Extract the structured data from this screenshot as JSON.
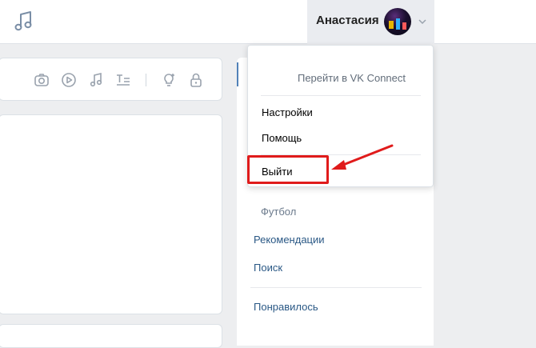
{
  "header": {
    "user_name": "Анастасия"
  },
  "dropdown": {
    "connect_label": "Перейти в VK Connect",
    "items": [
      {
        "label": "Настройки"
      },
      {
        "label": "Помощь"
      },
      {
        "label": "Выйти"
      }
    ]
  },
  "right_menu": {
    "sub_item": "Футбол",
    "links": [
      "Рекомендации",
      "Поиск",
      "Понравилось"
    ]
  },
  "colors": {
    "accent": "#5181b8",
    "link": "#2a5885",
    "highlight": "#e01b1b"
  }
}
